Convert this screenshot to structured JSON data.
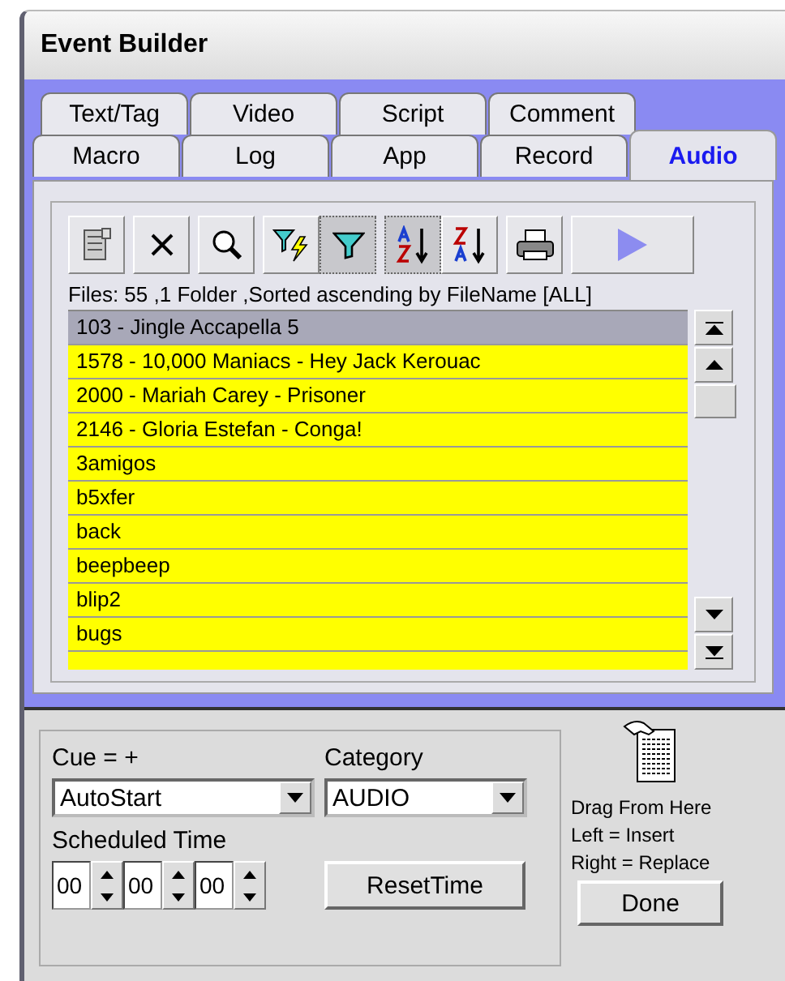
{
  "window": {
    "title": "Event Builder"
  },
  "tab_rows": [
    {
      "tabs": [
        {
          "label": "Text/Tag",
          "selected": false
        },
        {
          "label": "Video",
          "selected": false
        },
        {
          "label": "Script",
          "selected": false
        },
        {
          "label": "Comment",
          "selected": false
        }
      ]
    },
    {
      "tabs": [
        {
          "label": "Macro",
          "selected": false
        },
        {
          "label": "Log",
          "selected": false
        },
        {
          "label": "App",
          "selected": false
        },
        {
          "label": "Record",
          "selected": false
        },
        {
          "label": "Audio",
          "selected": true
        }
      ]
    }
  ],
  "toolbar": [
    {
      "kind": "list",
      "pressed": false
    },
    {
      "kind": "delete",
      "pressed": false
    },
    {
      "kind": "search",
      "pressed": false
    },
    {
      "kind": "filter-lightning",
      "pressed": false
    },
    {
      "kind": "filter",
      "pressed": true
    },
    {
      "kind": "sort-az",
      "pressed": true
    },
    {
      "kind": "sort-za",
      "pressed": false
    },
    {
      "kind": "print",
      "pressed": false
    },
    {
      "kind": "play",
      "pressed": false
    }
  ],
  "files_summary": "Files: 55 ,1 Folder ,Sorted ascending by FileName [ALL]",
  "files": [
    {
      "name": "103 - Jingle Accapella 5",
      "selected": true
    },
    {
      "name": "1578 - 10,000 Maniacs - Hey Jack Kerouac",
      "selected": false
    },
    {
      "name": "2000 - Mariah Carey - Prisoner",
      "selected": false
    },
    {
      "name": "2146 - Gloria Estefan - Conga!",
      "selected": false
    },
    {
      "name": "3amigos",
      "selected": false
    },
    {
      "name": "b5xfer",
      "selected": false
    },
    {
      "name": "back",
      "selected": false
    },
    {
      "name": "beepbeep",
      "selected": false
    },
    {
      "name": "blip2",
      "selected": false
    },
    {
      "name": "bugs",
      "selected": false
    }
  ],
  "cue": {
    "label": "Cue = +",
    "value": "AutoStart"
  },
  "category": {
    "label": "Category",
    "value": "AUDIO"
  },
  "scheduled_time": {
    "label": "Scheduled Time",
    "fields": [
      "00",
      "00",
      "00"
    ]
  },
  "reset_button": "ResetTime",
  "drag_hint": [
    "Drag From Here",
    "Left = Insert",
    "Right = Replace"
  ],
  "done_button": "Done"
}
